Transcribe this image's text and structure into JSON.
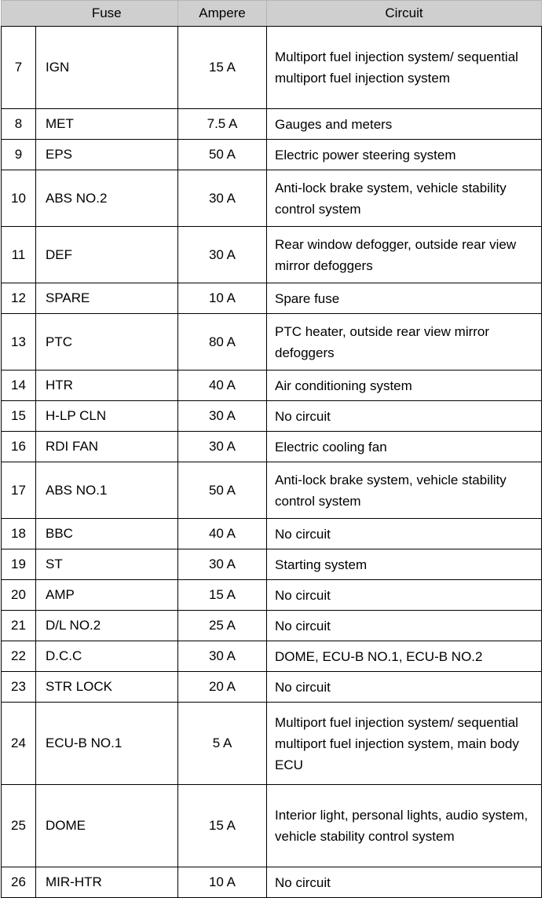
{
  "table": {
    "headers": {
      "number": "",
      "fuse": "Fuse",
      "ampere": "Ampere",
      "circuit": "Circuit"
    },
    "rows": [
      {
        "no": "7",
        "fuse": "IGN",
        "ampere": "15 A",
        "circuit": "Multiport fuel injection system/ sequential multiport fuel injection system",
        "lines": 3
      },
      {
        "no": "8",
        "fuse": "MET",
        "ampere": "7.5 A",
        "circuit": "Gauges and meters",
        "lines": 1
      },
      {
        "no": "9",
        "fuse": "EPS",
        "ampere": "50 A",
        "circuit": "Electric power steering system",
        "lines": 1
      },
      {
        "no": "10",
        "fuse": "ABS NO.2",
        "ampere": "30 A",
        "circuit": "Anti-lock brake system, vehicle stability control system",
        "lines": 2
      },
      {
        "no": "11",
        "fuse": "DEF",
        "ampere": "30 A",
        "circuit": "Rear window defogger, outside rear view mirror defoggers",
        "lines": 2
      },
      {
        "no": "12",
        "fuse": "SPARE",
        "ampere": "10 A",
        "circuit": "Spare fuse",
        "lines": 1
      },
      {
        "no": "13",
        "fuse": "PTC",
        "ampere": "80 A",
        "circuit": "PTC heater, outside rear view mirror defoggers",
        "lines": 2
      },
      {
        "no": "14",
        "fuse": "HTR",
        "ampere": "40 A",
        "circuit": "Air conditioning system",
        "lines": 1
      },
      {
        "no": "15",
        "fuse": "H-LP CLN",
        "ampere": "30 A",
        "circuit": "No circuit",
        "lines": 1
      },
      {
        "no": "16",
        "fuse": "RDI FAN",
        "ampere": "30 A",
        "circuit": "Electric cooling fan",
        "lines": 1
      },
      {
        "no": "17",
        "fuse": "ABS NO.1",
        "ampere": "50 A",
        "circuit": "Anti-lock brake system, vehicle stability control system",
        "lines": 2
      },
      {
        "no": "18",
        "fuse": "BBC",
        "ampere": "40 A",
        "circuit": "No circuit",
        "lines": 1
      },
      {
        "no": "19",
        "fuse": "ST",
        "ampere": "30 A",
        "circuit": "Starting system",
        "lines": 1
      },
      {
        "no": "20",
        "fuse": "AMP",
        "ampere": "15 A",
        "circuit": "No circuit",
        "lines": 1
      },
      {
        "no": "21",
        "fuse": "D/L NO.2",
        "ampere": "25 A",
        "circuit": "No circuit",
        "lines": 1
      },
      {
        "no": "22",
        "fuse": "D.C.C",
        "ampere": "30 A",
        "circuit": "DOME, ECU-B NO.1, ECU-B NO.2",
        "lines": 1
      },
      {
        "no": "23",
        "fuse": "STR LOCK",
        "ampere": "20 A",
        "circuit": "No circuit",
        "lines": 1
      },
      {
        "no": "24",
        "fuse": "ECU-B NO.1",
        "ampere": "5 A",
        "circuit": "Multiport fuel injection system/ sequential multiport fuel injection system, main body ECU",
        "lines": 3
      },
      {
        "no": "25",
        "fuse": "DOME",
        "ampere": "15 A",
        "circuit": "Interior light, personal lights, audio system, vehicle stability control system",
        "lines": 3
      },
      {
        "no": "26",
        "fuse": "MIR-HTR",
        "ampere": "10 A",
        "circuit": "No circuit",
        "lines": 1
      }
    ]
  },
  "colors": {
    "header_background": "#cfcfcf",
    "border": "#000000",
    "text": "#000000",
    "page_background": "#ffffff"
  }
}
